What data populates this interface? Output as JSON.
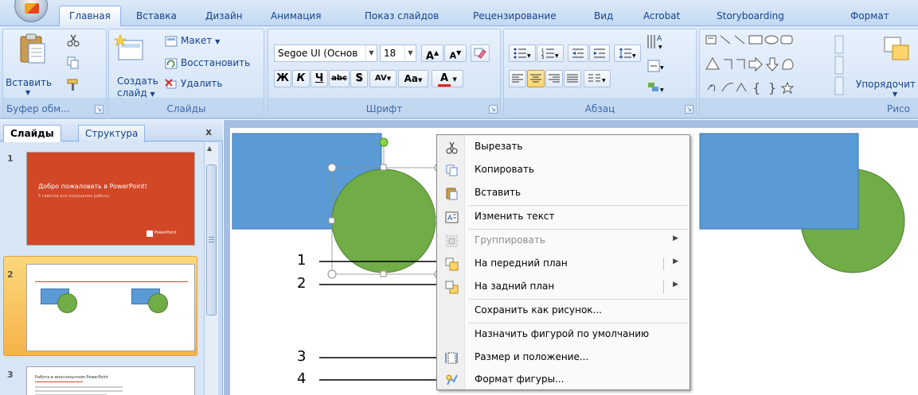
{
  "tabs": [
    {
      "label": "Главная",
      "active": true
    },
    {
      "label": "Вставка"
    },
    {
      "label": "Дизайн"
    },
    {
      "label": "Анимация"
    },
    {
      "label": "Показ слайдов"
    },
    {
      "label": "Рецензирование"
    },
    {
      "label": "Вид"
    },
    {
      "label": "Acrobat"
    },
    {
      "label": "Storyboarding"
    },
    {
      "label": "Формат"
    }
  ],
  "ribbon": {
    "clipboard": {
      "paste": "Вставить",
      "label": "Буфер обм..."
    },
    "slides": {
      "create": "Создать",
      "create2": "слайд",
      "layout": "Макет",
      "reset": "Восстановить",
      "delete": "Удалить",
      "label": "Слайды"
    },
    "font": {
      "name": "Segoe UI (Основ",
      "size": "18",
      "bold": "Ж",
      "italic": "К",
      "underline": "Ч",
      "strike": "abc",
      "shadow": "S",
      "spacing": "AV",
      "case": "Aa",
      "color": "A",
      "label": "Шрифт"
    },
    "paragraph": {
      "label": "Абзац"
    },
    "drawing": {
      "arrange": "Упорядочит",
      "label": "Рисо"
    }
  },
  "left_panel": {
    "tabs": [
      {
        "label": "Слайды",
        "active": true
      },
      {
        "label": "Структура"
      }
    ],
    "close": "x",
    "slides": [
      {
        "number": "1",
        "title": "Добро пожаловать в PowerPoint!",
        "subtitle": "5 советов для упрощения работы",
        "logo": "PowerPoint"
      },
      {
        "number": "2",
        "selected": true
      },
      {
        "number": "3",
        "title": "Работа в многоязычном PowerPoint"
      }
    ]
  },
  "context_menu": {
    "items": [
      {
        "label": "Вырезать",
        "icon": "scissors-icon"
      },
      {
        "label": "Копировать",
        "icon": "copy-icon"
      },
      {
        "label": "Вставить",
        "icon": "paste-icon"
      },
      {
        "label": "Изменить текст",
        "icon": "edit-text-icon"
      },
      {
        "label": "Группировать",
        "icon": "group-icon",
        "disabled": true,
        "submenu": true
      },
      {
        "label": "На передний план",
        "icon": "bring-front-icon",
        "submenu": true,
        "split": true
      },
      {
        "label": "На задний план",
        "icon": "send-back-icon",
        "submenu": true,
        "split": true
      },
      {
        "label": "Сохранить как рисунок..."
      },
      {
        "label": "Назначить фигурой по умолчанию"
      },
      {
        "label": "Размер и положение...",
        "icon": "size-position-icon"
      },
      {
        "label": "Формат фигуры...",
        "icon": "format-shape-icon"
      }
    ]
  },
  "callouts": [
    "1",
    "2",
    "3",
    "4"
  ],
  "colors": {
    "shape_blue": "#5b9bd5",
    "shape_green": "#70ad47",
    "title_red": "#d24726",
    "accent_orange": "#f6b24a"
  }
}
